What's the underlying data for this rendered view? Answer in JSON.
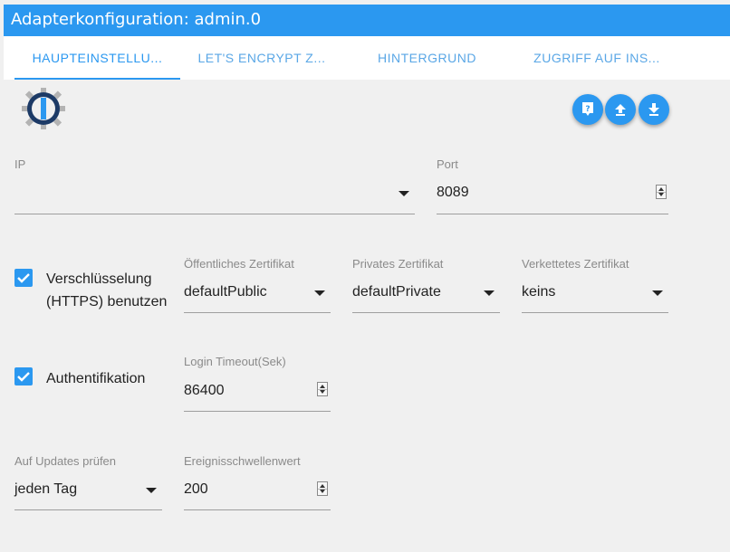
{
  "window": {
    "title": "Adapterkonfiguration: admin.0"
  },
  "tabs": [
    {
      "label": "HAUPTEINSTELLU..."
    },
    {
      "label": "LET'S ENCRYPT Z..."
    },
    {
      "label": "HINTERGRUND"
    },
    {
      "label": "ZUGRIFF AUF INS..."
    }
  ],
  "colors": {
    "accent": "#2b98f0",
    "checkbox": "#2b98f0",
    "logo_ring": "#1c3a66",
    "logo_gear": "#b3b3b3"
  },
  "icons": {
    "logo": "iobroker-logo",
    "help": "help-icon",
    "upload": "upload-icon",
    "download": "download-icon"
  },
  "form": {
    "ip": {
      "label": "IP",
      "value": ""
    },
    "port": {
      "label": "Port",
      "value": "8089"
    },
    "https": {
      "label": "Verschlüsselung (HTTPS) benutzen",
      "checked": true
    },
    "cert_public": {
      "label": "Öffentliches Zertifikat",
      "value": "defaultPublic"
    },
    "cert_private": {
      "label": "Privates Zertifikat",
      "value": "defaultPrivate"
    },
    "cert_chained": {
      "label": "Verkettetes Zertifikat",
      "value": "keins"
    },
    "auth": {
      "label": "Authentifikation",
      "checked": true
    },
    "login_timeout": {
      "label": "Login Timeout(Sek)",
      "value": "86400"
    },
    "updates": {
      "label": "Auf Updates prüfen",
      "value": "jeden Tag"
    },
    "event_threshold": {
      "label": "Ereignisschwellenwert",
      "value": "200"
    }
  }
}
